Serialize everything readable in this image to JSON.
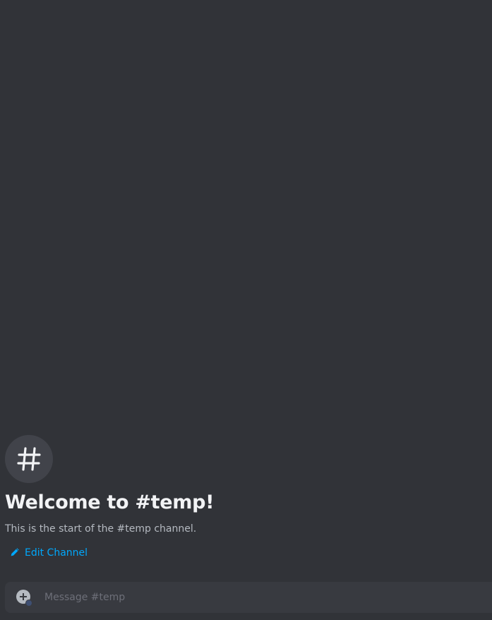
{
  "channel": {
    "icon": "hash-icon",
    "welcome_title": "Welcome to #temp!",
    "welcome_subtitle": "This is the start of the #temp channel."
  },
  "actions": {
    "edit_channel_label": "Edit Channel",
    "edit_icon": "pencil-icon"
  },
  "composer": {
    "placeholder": "Message #temp",
    "value": "",
    "attach_icon": "plus-circle-icon"
  },
  "colors": {
    "background": "#313338",
    "composer": "#383a40",
    "link": "#00a8fc",
    "heading": "#f2f3f5",
    "muted": "#b5bac1"
  }
}
